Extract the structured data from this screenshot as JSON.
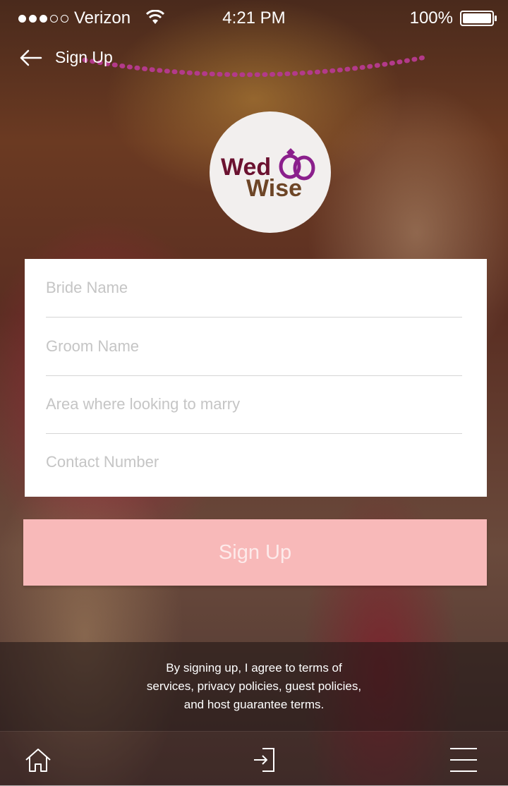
{
  "status_bar": {
    "carrier": "Verizon",
    "time": "4:21 PM",
    "battery": "100%"
  },
  "nav": {
    "title": "Sign Up"
  },
  "logo": {
    "line1": "Wed",
    "line2": "Wise"
  },
  "form": {
    "bride_placeholder": "Bride Name",
    "groom_placeholder": "Groom Name",
    "area_placeholder": "Area where looking to marry",
    "contact_placeholder": "Contact Number"
  },
  "signup_button": "Sign Up",
  "terms": {
    "line1": "By signing up, I agree to  terms of",
    "line2": "services, privacy policies, guest policies,",
    "line3": "and host guarantee terms."
  },
  "tab_bar": {
    "items": [
      {
        "icon": "home-icon"
      },
      {
        "icon": "sign-in-icon"
      },
      {
        "icon": "menu-icon"
      }
    ]
  },
  "colors": {
    "brand_maroon": "#6b1230",
    "brand_brown": "#6d4526",
    "ring_purple": "#8b1f8c",
    "button_pink": "#f8b9b9"
  }
}
